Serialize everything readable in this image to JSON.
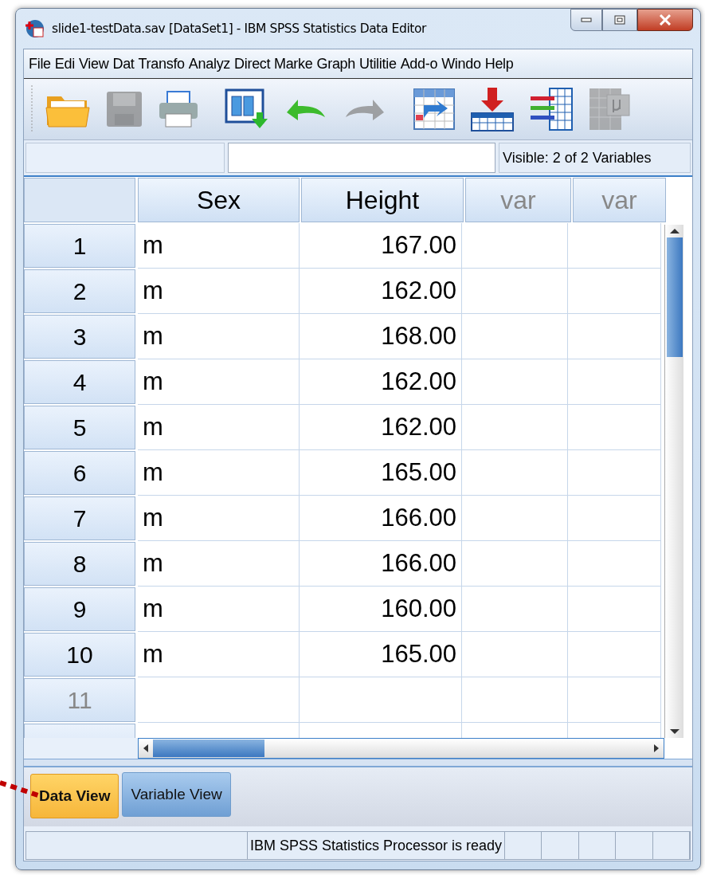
{
  "window": {
    "title": "slide1-testData.sav [DataSet1] - IBM SPSS Statistics Data Editor"
  },
  "menu": [
    "File",
    "Edi",
    "View",
    "Dat",
    "Transfo",
    "Analyz",
    "Direct Marke",
    "Graph",
    "Utilitie",
    "Add-o",
    "Windo",
    "Help"
  ],
  "toolbar": [
    {
      "kind": "open",
      "disabled": false
    },
    {
      "kind": "save",
      "disabled": true
    },
    {
      "kind": "print",
      "disabled": false
    },
    {
      "kind": "recall",
      "disabled": false
    },
    {
      "kind": "undo",
      "disabled": false
    },
    {
      "kind": "redo",
      "disabled": true
    },
    {
      "kind": "goto",
      "disabled": false
    },
    {
      "kind": "insert",
      "disabled": false
    },
    {
      "kind": "variables",
      "disabled": false
    },
    {
      "kind": "mu",
      "disabled": true
    }
  ],
  "cell_bar": {
    "visible": "Visible: 2 of 2 Variables"
  },
  "table": {
    "columns": [
      {
        "label": "Sex",
        "kind": "string"
      },
      {
        "label": "Height",
        "kind": "numeric"
      },
      {
        "label": "var",
        "kind": "empty"
      },
      {
        "label": "var",
        "kind": "empty"
      }
    ],
    "rows": [
      {
        "number": "1",
        "empty": false,
        "cells": [
          "m",
          "167.00"
        ]
      },
      {
        "number": "2",
        "empty": false,
        "cells": [
          "m",
          "162.00"
        ]
      },
      {
        "number": "3",
        "empty": false,
        "cells": [
          "m",
          "168.00"
        ]
      },
      {
        "number": "4",
        "empty": false,
        "cells": [
          "m",
          "162.00"
        ]
      },
      {
        "number": "5",
        "empty": false,
        "cells": [
          "m",
          "162.00"
        ]
      },
      {
        "number": "6",
        "empty": false,
        "cells": [
          "m",
          "165.00"
        ]
      },
      {
        "number": "7",
        "empty": false,
        "cells": [
          "m",
          "166.00"
        ]
      },
      {
        "number": "8",
        "empty": false,
        "cells": [
          "m",
          "166.00"
        ]
      },
      {
        "number": "9",
        "empty": false,
        "cells": [
          "m",
          "160.00"
        ]
      },
      {
        "number": "10",
        "empty": false,
        "cells": [
          "m",
          "165.00"
        ]
      },
      {
        "number": "11",
        "empty": true,
        "cells": []
      }
    ]
  },
  "tabs": [
    {
      "label": "Data View",
      "selected": true
    },
    {
      "label": "Variable View",
      "selected": false
    }
  ],
  "status_bar": {
    "message": "IBM SPSS Statistics Processor is ready"
  }
}
